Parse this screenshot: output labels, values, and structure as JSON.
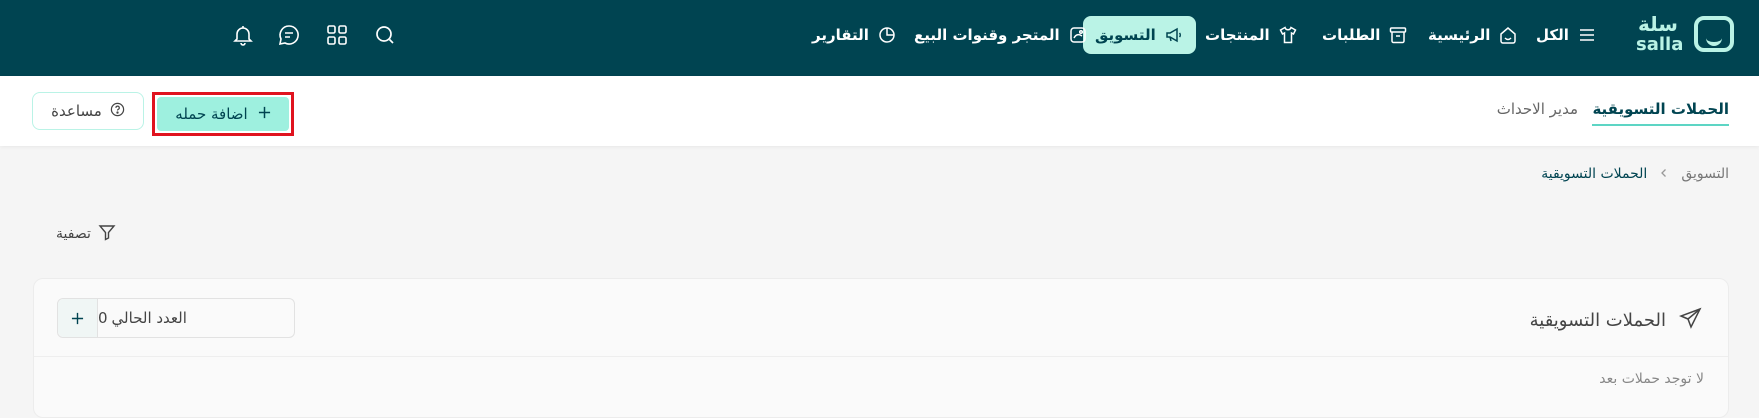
{
  "brand": {
    "name_ar": "سلة",
    "name_en": "salla"
  },
  "nav": {
    "items": [
      {
        "label": "الكل",
        "icon": "menu-icon"
      },
      {
        "label": "الرئيسية",
        "icon": "home-icon"
      },
      {
        "label": "الطلبات",
        "icon": "archive-box-icon"
      },
      {
        "label": "المنتجات",
        "icon": "shirt-icon"
      },
      {
        "label": "التسويق",
        "icon": "megaphone-icon",
        "active": true
      },
      {
        "label": "المتجر وقنوات البيع",
        "icon": "store-channels-icon"
      },
      {
        "label": "التقارير",
        "icon": "pie-chart-icon"
      }
    ],
    "utility_icons": [
      "search-icon",
      "apps-grid-icon",
      "chat-icon",
      "bell-icon"
    ]
  },
  "subnav": {
    "tabs": [
      {
        "label": "الحملات التسويقية",
        "active": true
      },
      {
        "label": "مدير الاحداث",
        "active": false
      }
    ],
    "add_button": "اضافة حمله",
    "help_button": "مساعدة"
  },
  "breadcrumb": {
    "parent": "التسويق",
    "current": "الحملات التسويقية"
  },
  "filter_label": "تصفية",
  "campaigns_card": {
    "title": "الحملات التسويقية",
    "counter_label": "العدد الحالي",
    "counter_value": "0",
    "empty_message": "لا توجد حملات بعد"
  },
  "colors": {
    "navbar": "#004451",
    "accent": "#baf3e6",
    "add_button": "#9ef0df",
    "highlight_border": "#e0131f"
  }
}
